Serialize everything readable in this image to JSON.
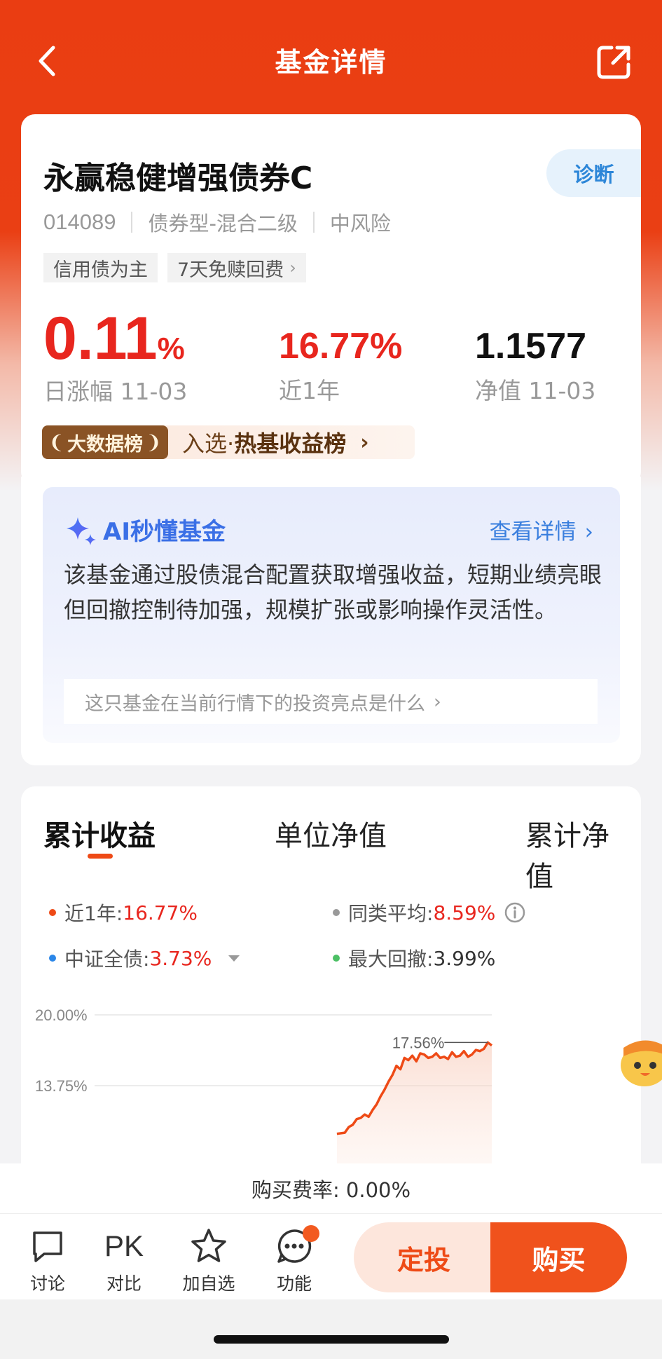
{
  "header": {
    "title": "基金详情",
    "back_icon": "chevron-left-icon",
    "share_icon": "share-icon"
  },
  "fund": {
    "name": "永赢稳健增强债券C",
    "diagnose_label": "诊断",
    "code": "014089",
    "type": "债券型-混合二级",
    "risk": "中风险",
    "tags": [
      "信用债为主",
      "7天免赎回费"
    ],
    "daily_change": "0.11",
    "daily_change_unit": "%",
    "daily_change_label": "日涨幅 11-03",
    "one_year": "16.77%",
    "one_year_label": "近1年",
    "nav": "1.1577",
    "nav_label": "净值 11-03",
    "rank_badge": "大数据榜",
    "rank_text_prefix": "入选·",
    "rank_text_name": "热基收益榜"
  },
  "ai": {
    "title": "AI秒懂基金",
    "detail_label": "查看详情",
    "summary": "该基金通过股债混合配置获取增强收益，短期业绩亮眼但回撤控制待加强，规模扩张或影响操作灵活性。",
    "question": "这只基金在当前行情下的投资亮点是什么"
  },
  "chart_tabs": [
    "累计收益",
    "单位净值",
    "累计净值"
  ],
  "legend": {
    "fund_label": "近1年:",
    "fund_value": "16.77%",
    "peer_label": "同类平均:",
    "peer_value": "8.59%",
    "index_label": "中证全债:",
    "index_value": "3.73%",
    "drawdown_label": "最大回撤:",
    "drawdown_value": "3.99%",
    "colors": {
      "fund": "#ee4a16",
      "peer": "#999999",
      "index": "#2a86e8",
      "drawdown": "#4cc065"
    }
  },
  "chart_data": {
    "type": "area",
    "ytick_labels": [
      "20.00%",
      "13.75%"
    ],
    "y_ticks": [
      20.0,
      13.75
    ],
    "max_label": "17.56%",
    "series": [
      {
        "color": "#ee4a16",
        "x": [
          0.61,
          0.63,
          0.64,
          0.65,
          0.66,
          0.67,
          0.68,
          0.69,
          0.7,
          0.71,
          0.72,
          0.73,
          0.74,
          0.75,
          0.76,
          0.77,
          0.78,
          0.79,
          0.8,
          0.81,
          0.82,
          0.83,
          0.84,
          0.85,
          0.86,
          0.87,
          0.88,
          0.89,
          0.9,
          0.91,
          0.92,
          0.93,
          0.94,
          0.95,
          0.96,
          0.97,
          0.98,
          0.99,
          1.0
        ],
        "y": [
          9.5,
          9.6,
          10.1,
          10.3,
          10.8,
          10.9,
          11.2,
          11.0,
          11.6,
          12.1,
          12.8,
          13.4,
          14.1,
          14.7,
          15.5,
          15.2,
          16.2,
          16.0,
          16.4,
          15.9,
          16.6,
          16.5,
          16.2,
          16.3,
          16.6,
          16.2,
          16.3,
          16.1,
          16.7,
          16.3,
          16.4,
          16.8,
          16.3,
          16.5,
          16.9,
          16.8,
          17.0,
          17.56,
          17.3
        ]
      }
    ]
  },
  "bottom": {
    "fee_text": "购买费率: 0.00%",
    "items": [
      {
        "label": "讨论",
        "icon": "chat-icon"
      },
      {
        "label": "对比",
        "icon_text": "PK"
      },
      {
        "label": "加自选",
        "icon": "star-icon"
      },
      {
        "label": "功能",
        "icon": "more-icon"
      }
    ],
    "invest_label": "定投",
    "buy_label": "购买"
  }
}
